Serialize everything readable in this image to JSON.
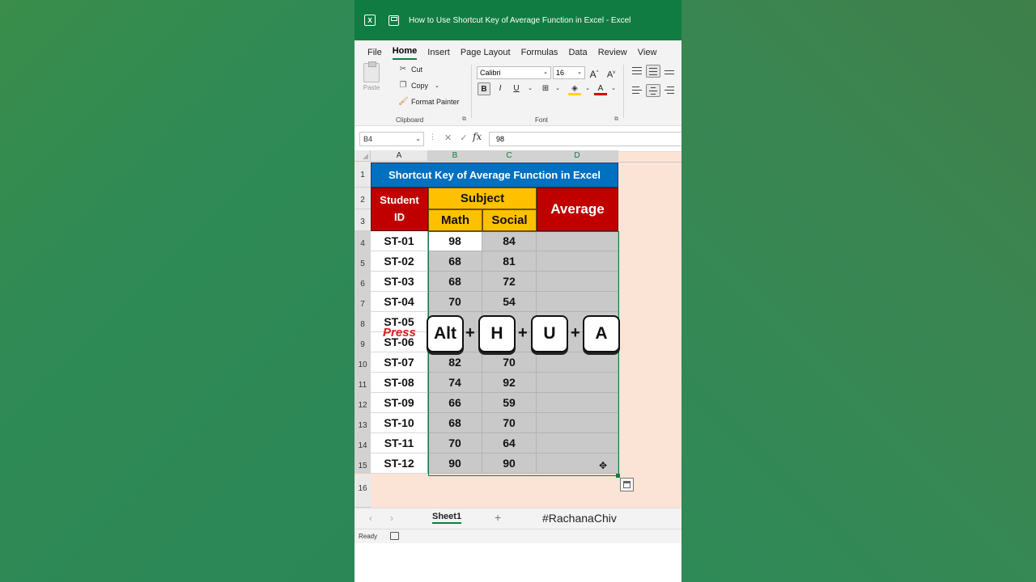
{
  "window": {
    "title": "How to Use Shortcut Key of Average Function in Excel  -  Excel"
  },
  "menu": {
    "tabs": [
      "File",
      "Home",
      "Insert",
      "Page Layout",
      "Formulas",
      "Data",
      "Review",
      "View"
    ],
    "active": "Home"
  },
  "ribbon": {
    "clipboard": {
      "paste": "Paste",
      "cut": "Cut",
      "copy": "Copy",
      "format_painter": "Format Painter",
      "label": "Clipboard"
    },
    "font": {
      "name": "Calibri",
      "size": "16",
      "bold": "B",
      "italic": "I",
      "underline": "U",
      "label": "Font",
      "grow": "A",
      "shrink": "A"
    }
  },
  "formula_bar": {
    "name_box": "B4",
    "fx": "fx",
    "value": "98"
  },
  "sheet": {
    "columns": [
      "A",
      "B",
      "C",
      "D"
    ],
    "rows": [
      "1",
      "2",
      "3",
      "4",
      "5",
      "6",
      "7",
      "8",
      "9",
      "10",
      "11",
      "12",
      "13",
      "14",
      "15",
      "16"
    ],
    "table_title": "Shortcut Key of Average Function in Excel",
    "header_student_id": "Student ID",
    "header_subject": "Subject",
    "header_math": "Math",
    "header_social": "Social",
    "header_average": "Average",
    "records": [
      {
        "id": "ST-01",
        "math": "98",
        "social": "84"
      },
      {
        "id": "ST-02",
        "math": "68",
        "social": "81"
      },
      {
        "id": "ST-03",
        "math": "68",
        "social": "72"
      },
      {
        "id": "ST-04",
        "math": "70",
        "social": "54"
      },
      {
        "id": "ST-05",
        "math": "",
        "social": ""
      },
      {
        "id": "ST-06",
        "math": "",
        "social": ""
      },
      {
        "id": "ST-07",
        "math": "82",
        "social": "70"
      },
      {
        "id": "ST-08",
        "math": "74",
        "social": "92"
      },
      {
        "id": "ST-09",
        "math": "66",
        "social": "59"
      },
      {
        "id": "ST-10",
        "math": "68",
        "social": "70"
      },
      {
        "id": "ST-11",
        "math": "70",
        "social": "64"
      },
      {
        "id": "ST-12",
        "math": "90",
        "social": "90"
      }
    ]
  },
  "overlay": {
    "press": "Press",
    "keys": [
      "Alt",
      "H",
      "U",
      "A"
    ],
    "plus": "+"
  },
  "sheet_tabs": {
    "active": "Sheet1",
    "add": "+",
    "hashtag": "#RachanaChiv",
    "prev": "‹",
    "next": "›"
  },
  "status": {
    "ready": "Ready"
  }
}
